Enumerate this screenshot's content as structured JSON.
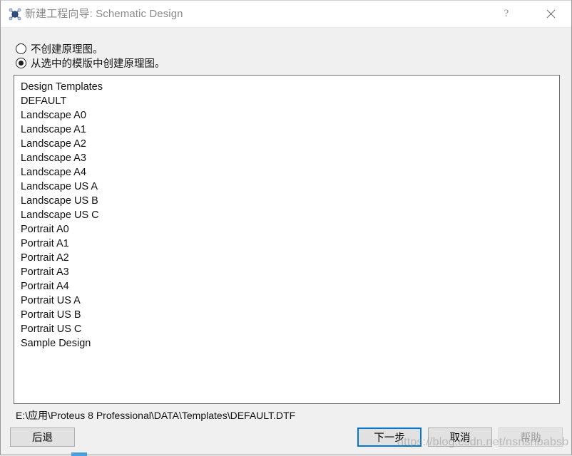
{
  "window": {
    "title": "新建工程向导: Schematic Design",
    "icon": "proteus-app-icon",
    "help_icon": "?",
    "close_icon": "×"
  },
  "options": [
    {
      "label": "不创建原理图。",
      "selected": false,
      "name": "radio-no-schematic"
    },
    {
      "label": "从选中的模版中创建原理图。",
      "selected": true,
      "name": "radio-from-template"
    }
  ],
  "list": {
    "items": [
      "Design Templates",
      "DEFAULT",
      "Landscape A0",
      "Landscape A1",
      "Landscape A2",
      "Landscape A3",
      "Landscape A4",
      "Landscape US A",
      "Landscape US B",
      "Landscape US C",
      "Portrait A0",
      "Portrait A1",
      "Portrait A2",
      "Portrait A3",
      "Portrait A4",
      "Portrait US A",
      "Portrait US B",
      "Portrait US C",
      "Sample Design"
    ]
  },
  "path": "E:\\应用\\Proteus 8 Professional\\DATA\\Templates\\DEFAULT.DTF",
  "buttons": {
    "back": "后退",
    "next": "下一步",
    "cancel": "取消",
    "help": "帮助"
  },
  "watermark": {
    "text": "https://blog.csdn.net/nsnsnbabsb"
  },
  "colors": {
    "accent": "#0078d7",
    "dialog_bg": "#f0f0f0",
    "titlebar_bg": "#ffffff",
    "list_bg": "#ffffff",
    "button_bg": "#e1e1e1",
    "disabled_text": "#9d9d9d"
  }
}
